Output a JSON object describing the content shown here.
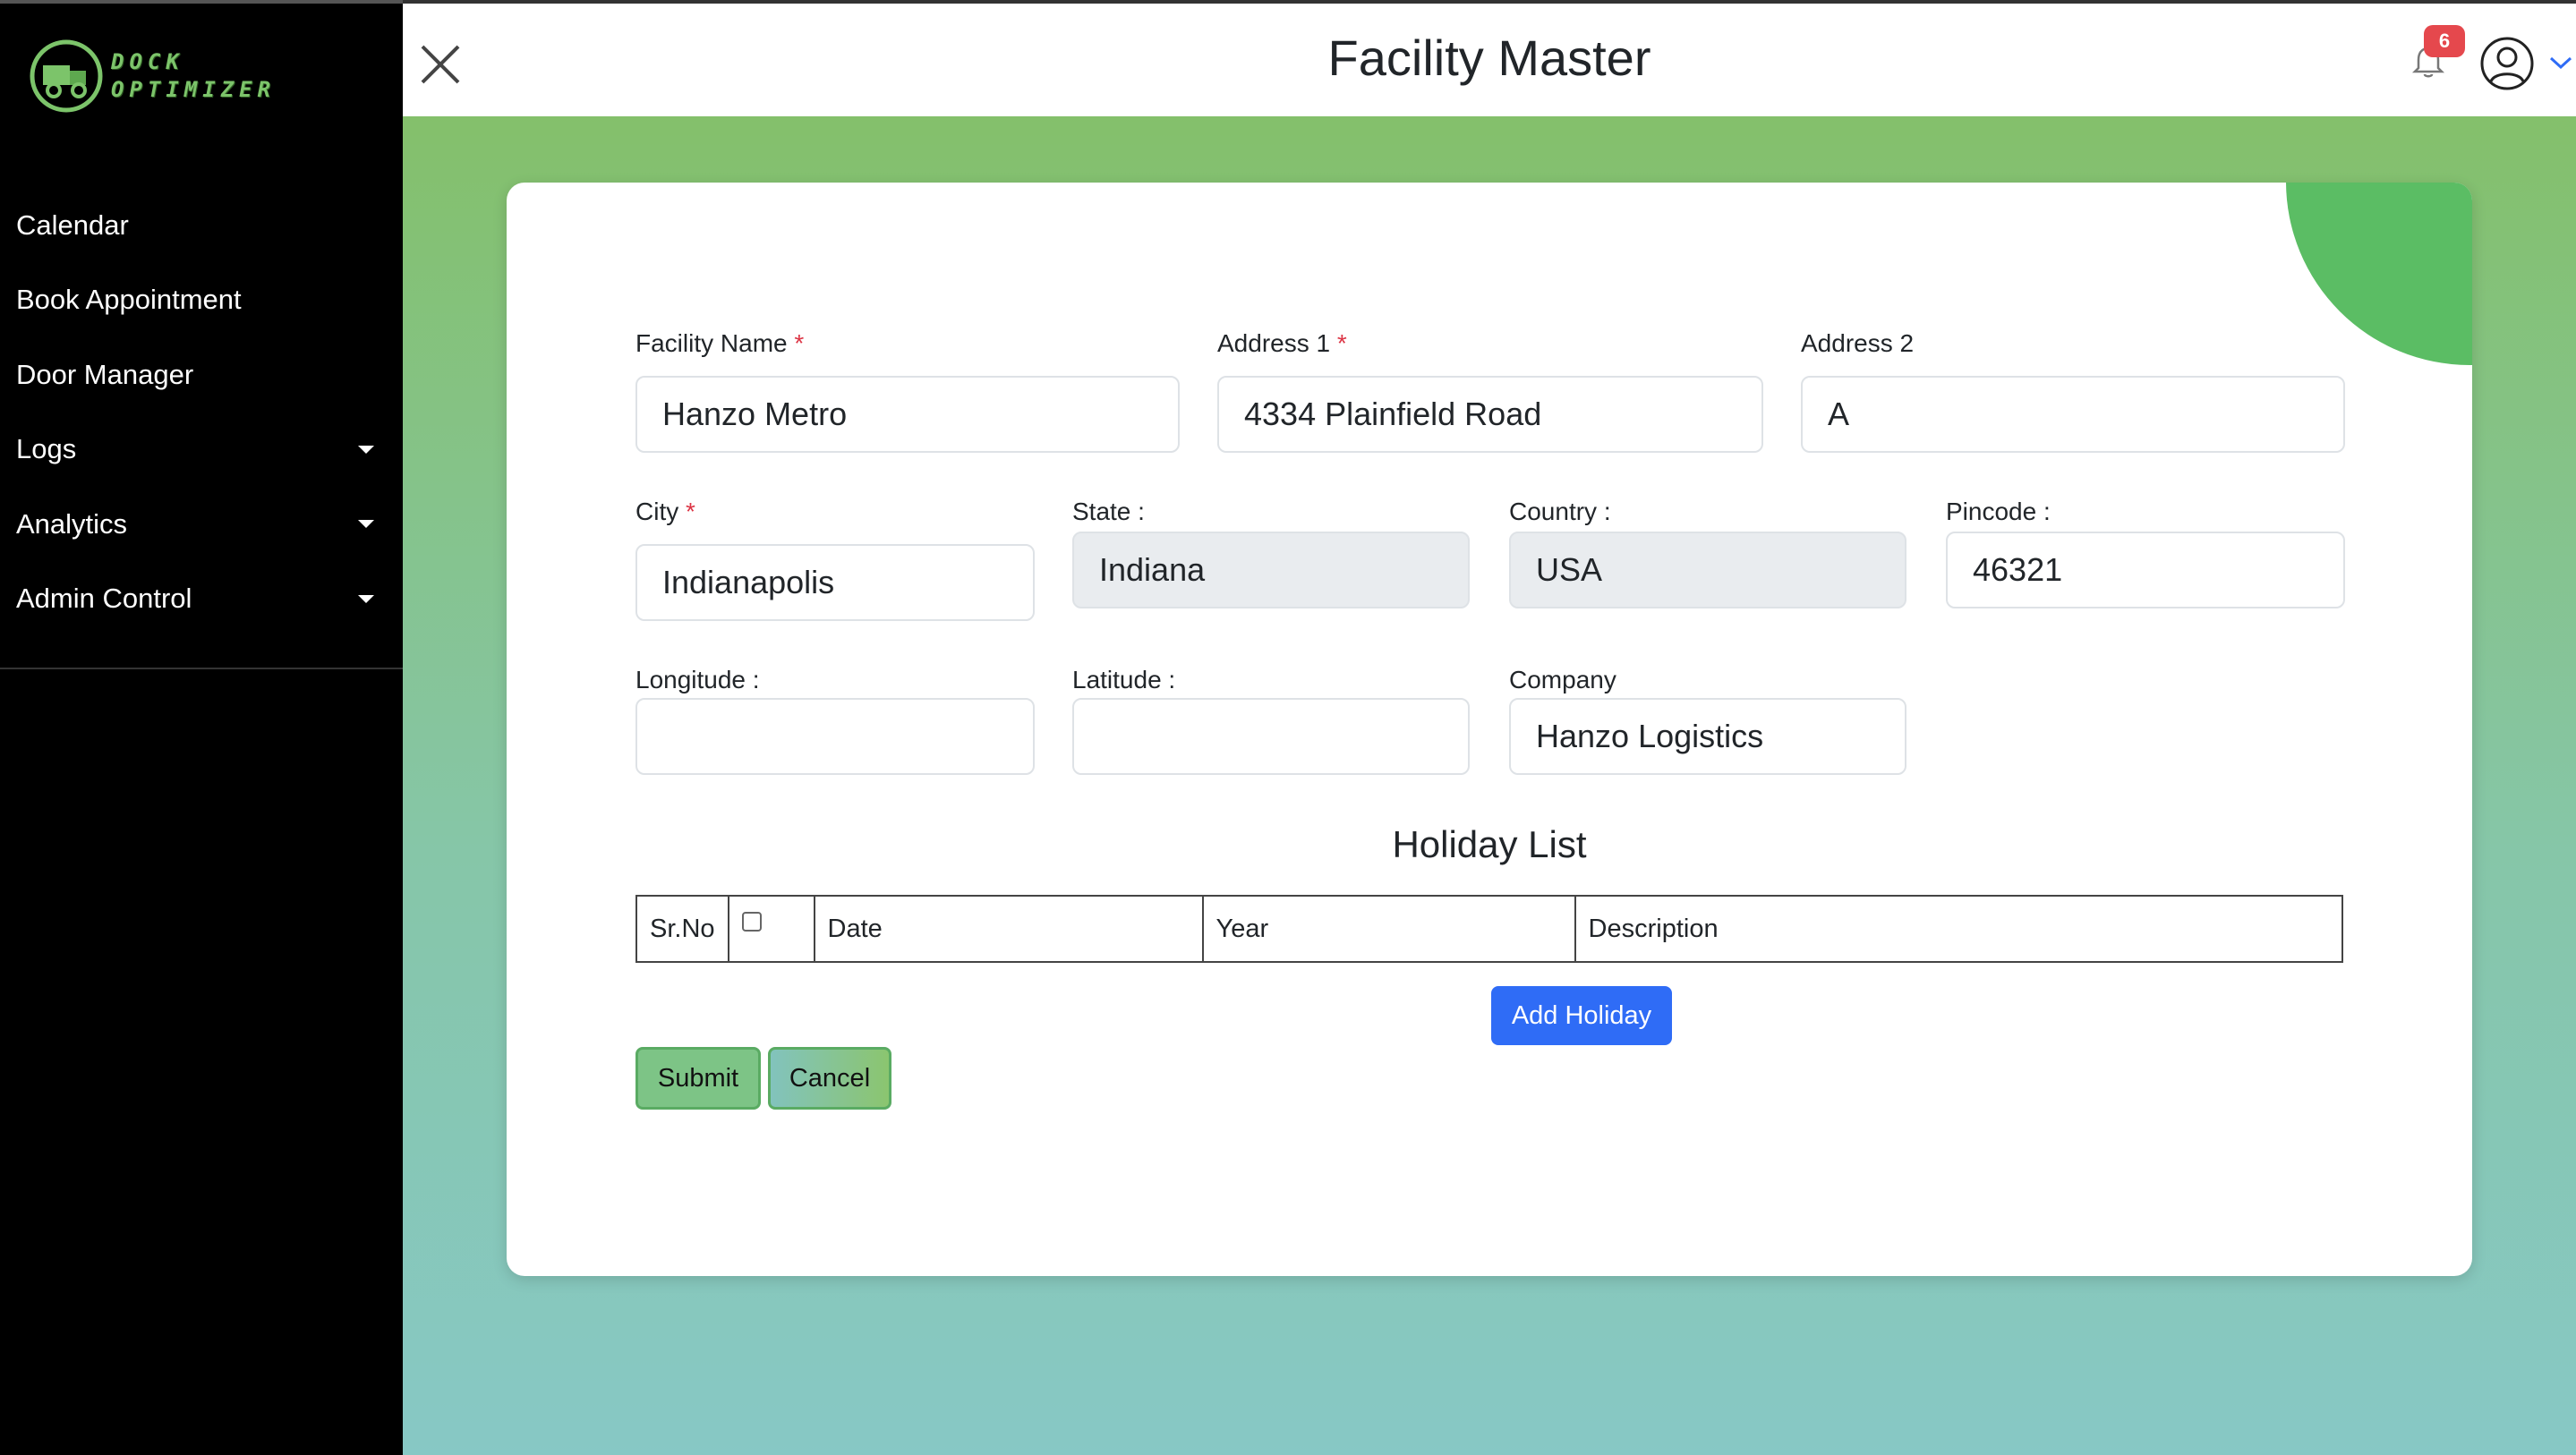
{
  "app": {
    "logo_text_line1": "DOCK",
    "logo_text_line2": "OPTIMIZER"
  },
  "sidebar": {
    "items": [
      {
        "label": "Calendar",
        "has_caret": false
      },
      {
        "label": "Book Appointment",
        "has_caret": false
      },
      {
        "label": "Door Manager",
        "has_caret": false
      },
      {
        "label": "Logs",
        "has_caret": true
      },
      {
        "label": "Analytics",
        "has_caret": true
      },
      {
        "label": "Admin Control",
        "has_caret": true
      }
    ]
  },
  "header": {
    "title": "Facility Master",
    "notification_count": "6",
    "icons": [
      "close-icon",
      "bell-icon",
      "user-circle-icon",
      "chevron-down-icon"
    ]
  },
  "form": {
    "facility_name": {
      "label": "Facility Name",
      "required": true,
      "value": "Hanzo Metro"
    },
    "address1": {
      "label": "Address 1",
      "required": true,
      "value": "4334 Plainfield Road"
    },
    "address2": {
      "label": "Address 2",
      "required": false,
      "value": "A"
    },
    "city": {
      "label": "City",
      "required": true,
      "value": "Indianapolis"
    },
    "state": {
      "label": "State :",
      "value": "Indiana",
      "disabled": true
    },
    "country": {
      "label": "Country :",
      "value": "USA",
      "disabled": true
    },
    "pincode": {
      "label": "Pincode :",
      "value": "46321"
    },
    "longitude": {
      "label": "Longitude :",
      "value": ""
    },
    "latitude": {
      "label": "Latitude :",
      "value": ""
    },
    "company": {
      "label": "Company",
      "value": "Hanzo Logistics"
    }
  },
  "holiday": {
    "title": "Holiday List",
    "columns": [
      "Sr.No",
      "",
      "Date",
      "Year",
      "Description"
    ],
    "add_label": "Add Holiday"
  },
  "actions": {
    "submit_label": "Submit",
    "cancel_label": "Cancel"
  },
  "colors": {
    "accent_blue": "#2f6cf6",
    "brand_green": "#5bbd64",
    "required_red": "#dc3545",
    "badge_red": "#e5484d"
  }
}
